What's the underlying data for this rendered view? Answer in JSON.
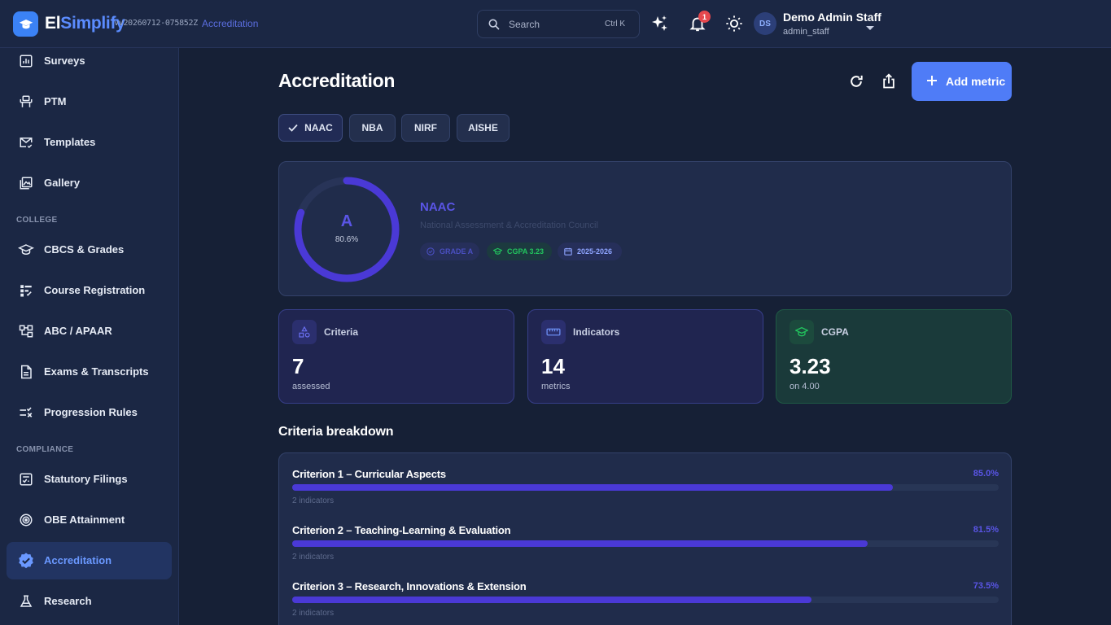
{
  "header": {
    "brand_part1": "El",
    "brand_part2": "Simplify",
    "version": "vv20260712-075852Z",
    "breadcrumb": "Accreditation",
    "search_placeholder": "Search",
    "search_shortcut": "Ctrl K",
    "notification_count": "1",
    "user_initials": "DS",
    "user_name": "Demo Admin Staff",
    "user_role": "admin_staff"
  },
  "sidebar": {
    "items_top": [
      {
        "label": "Surveys",
        "icon": "bar-chart-icon"
      },
      {
        "label": "PTM",
        "icon": "meeting-icon"
      },
      {
        "label": "Templates",
        "icon": "mail-template-icon"
      },
      {
        "label": "Gallery",
        "icon": "image-icon"
      }
    ],
    "section_college": "COLLEGE",
    "items_college": [
      {
        "label": "CBCS & Grades",
        "icon": "graduation-cap-icon"
      },
      {
        "label": "Course Registration",
        "icon": "checklist-icon"
      },
      {
        "label": "ABC / APAAR",
        "icon": "hierarchy-icon"
      },
      {
        "label": "Exams & Transcripts",
        "icon": "document-icon"
      },
      {
        "label": "Progression Rules",
        "icon": "rule-icon"
      }
    ],
    "section_compliance": "COMPLIANCE",
    "items_compliance": [
      {
        "label": "Statutory Filings",
        "icon": "filing-icon"
      },
      {
        "label": "OBE Attainment",
        "icon": "target-icon"
      },
      {
        "label": "Accreditation",
        "icon": "verified-badge-icon",
        "active": true
      },
      {
        "label": "Research",
        "icon": "flask-icon"
      }
    ]
  },
  "main": {
    "title": "Accreditation",
    "add_button": "Add metric",
    "tabs": [
      {
        "label": "NAAC",
        "active": true
      },
      {
        "label": "NBA"
      },
      {
        "label": "NIRF"
      },
      {
        "label": "AISHE"
      }
    ],
    "summary": {
      "grade": "A",
      "percent_label": "80.6%",
      "percent_value": 80.6,
      "name": "NAAC",
      "full_name": "National Assessment & Accreditation Council",
      "badge_grade": "GRADE A",
      "badge_cgpa": "CGPA 3.23",
      "badge_year": "2025-2026"
    },
    "stats": [
      {
        "label": "Criteria",
        "value": "7",
        "sub": "assessed",
        "icon": "shapes-icon"
      },
      {
        "label": "Indicators",
        "value": "14",
        "sub": "metrics",
        "icon": "ruler-icon"
      },
      {
        "label": "CGPA",
        "value": "3.23",
        "sub": "on 4.00",
        "icon": "graduation-cap-icon"
      }
    ],
    "breakdown_title": "Criteria breakdown",
    "criteria": [
      {
        "name": "Criterion 1 – Curricular Aspects",
        "percent_label": "85.0%",
        "percent": 85.0,
        "indicators": "2 indicators"
      },
      {
        "name": "Criterion 2 – Teaching-Learning & Evaluation",
        "percent_label": "81.5%",
        "percent": 81.5,
        "indicators": "2 indicators"
      },
      {
        "name": "Criterion 3 – Research, Innovations & Extension",
        "percent_label": "73.5%",
        "percent": 73.5,
        "indicators": "2 indicators"
      }
    ]
  },
  "colors": {
    "accent": "#4f7cf7",
    "progress": "#4a39d6",
    "success": "#22c55e",
    "background": "#162036"
  }
}
